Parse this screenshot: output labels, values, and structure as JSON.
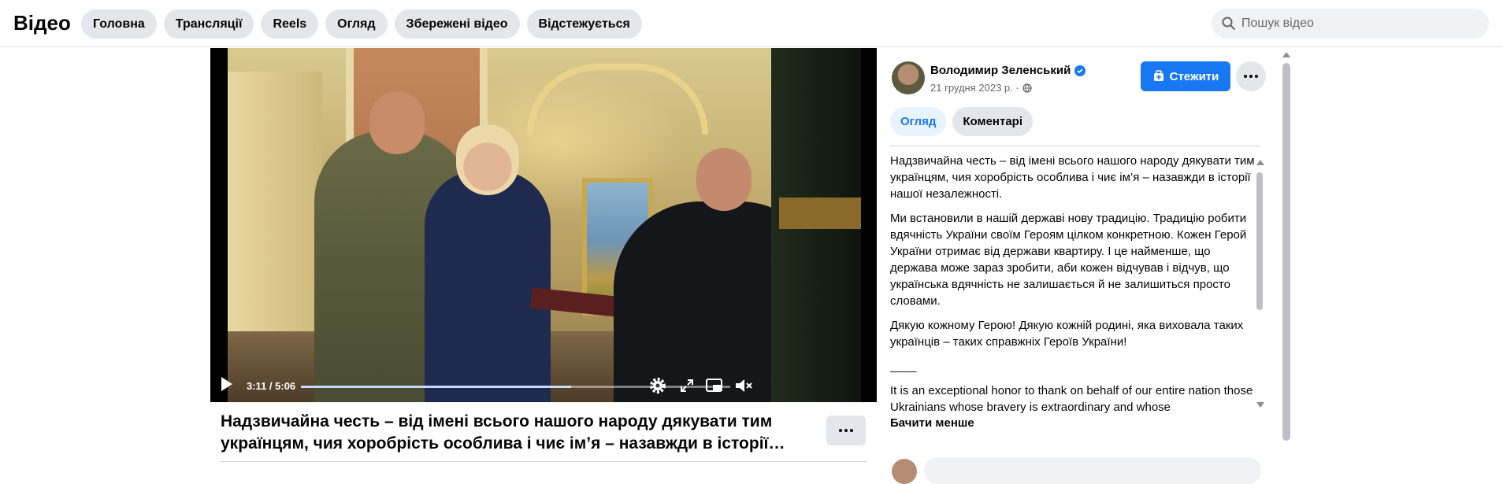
{
  "header": {
    "brand": "Відео",
    "tabs": [
      "Головна",
      "Трансляції",
      "Reels",
      "Огляд",
      "Збережені відео",
      "Відстежується"
    ],
    "search_placeholder": "Пошук відео",
    "search_icon": "search-icon"
  },
  "player": {
    "time": "3:11 / 5:06",
    "progress_fraction": 0.624,
    "buffered_fraction": 0.63,
    "accent_color": "#3b82f6",
    "icons": [
      "play-icon",
      "settings-icon",
      "fullscreen-icon",
      "miniplayer-icon",
      "volume-muted-icon"
    ]
  },
  "video_title": "Надзвичайна честь – від імені всього нашого народу дякувати тим українцям, чия хоробрість особлива і чиє ім’я – назавжди в історії нашої незалежності.",
  "post": {
    "author": "Володимир Зеленський",
    "date": "21 грудня 2023 р. ·",
    "follow_label": "Стежити",
    "tabs": [
      "Огляд",
      "Коментарі"
    ],
    "description": [
      "Надзвичайна честь – від імені всього нашого народу дякувати тим українцям, чия хоробрість особлива і чиє ім’я – назавжди в історії нашої незалежності.",
      "Ми встановили в нашій державі нову традицію. Традицію робити вдячність України своїм Героям цілком конкретною. Кожен Герой України отримає від держави квартиру. І це найменше, що держава може зараз зробити, аби кожен відчував і відчув, що українська вдячність не залишається й не залишиться просто словами.",
      "Дякую кожному Герою! Дякую кожній родині, яка виховала таких українців – таких справжніх Героїв України!",
      "____",
      "It is an exceptional honor to thank on behalf of our entire nation those Ukrainians whose bravery is extraordinary and whose"
    ],
    "see_less": "Бачити менше",
    "brand_color": "#1877f2"
  }
}
